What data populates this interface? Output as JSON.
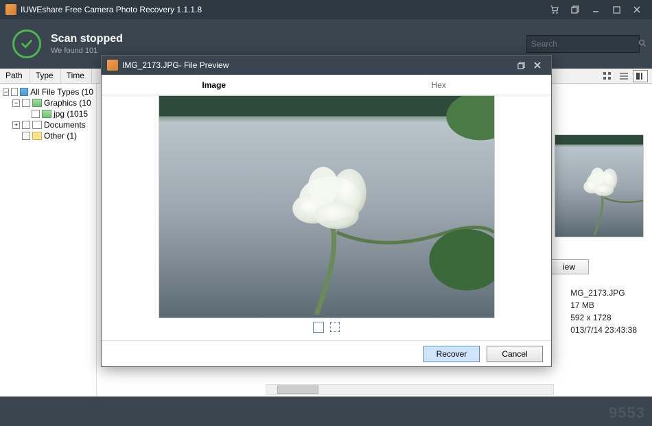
{
  "app": {
    "title": "IUWEshare Free Camera Photo Recovery 1.1.1.8"
  },
  "header": {
    "status_title": "Scan stopped",
    "status_sub": "We found 101",
    "search_placeholder": "Search"
  },
  "columns": {
    "path": "Path",
    "type": "Type",
    "time": "Time"
  },
  "tree": {
    "all": "All File Types (10",
    "graphics": "Graphics (10",
    "jpg": "jpg (1015",
    "documents": "Documents",
    "other": "Other (1)"
  },
  "preview_btn": "iew",
  "meta": {
    "name": "MG_2173.JPG",
    "size": "17 MB",
    "dims": "592 x 1728",
    "date": "013/7/14 23:43:38"
  },
  "dialog": {
    "title": "IMG_2173.JPG- File Preview",
    "tab_image": "Image",
    "tab_hex": "Hex",
    "recover": "Recover",
    "cancel": "Cancel"
  },
  "watermark": "9553"
}
